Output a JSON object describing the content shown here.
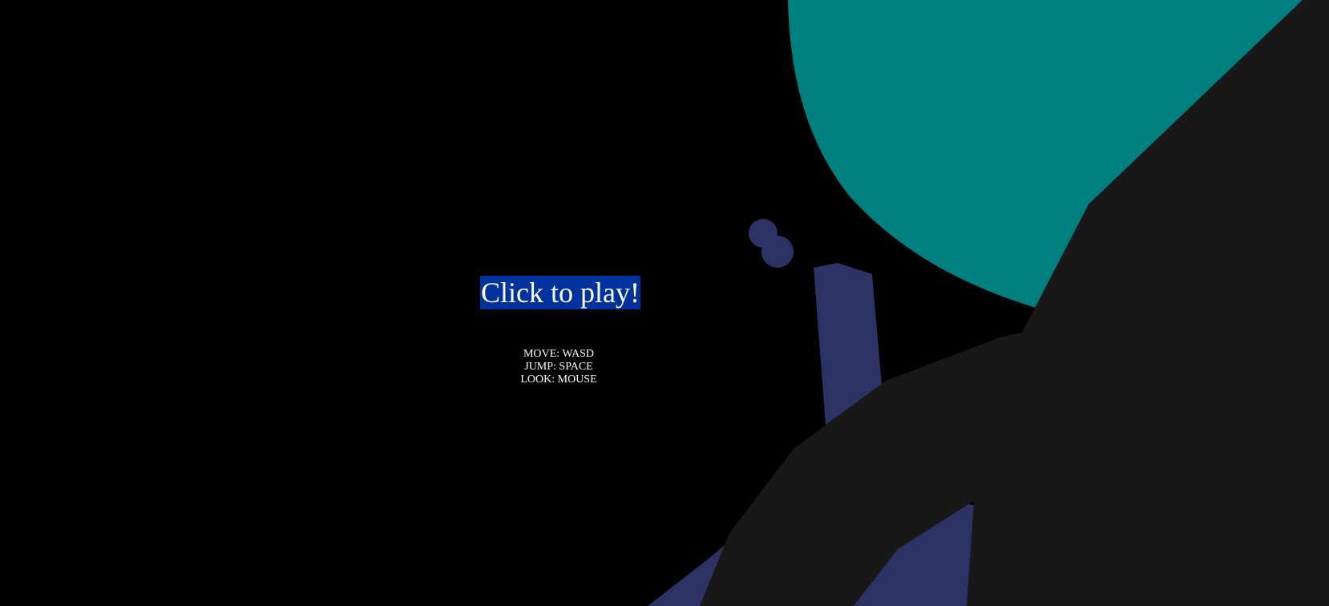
{
  "colors": {
    "background": "#000000",
    "sky_disc": "#007f7f",
    "terrain": "#181818",
    "pillar": "#2c3264",
    "button_background": "#00329e",
    "text": "#ffffff"
  },
  "menu": {
    "play_label": "Click to play!",
    "controls": [
      {
        "label": "MOVE: WASD"
      },
      {
        "label": "JUMP: SPACE"
      },
      {
        "label": "LOOK: MOUSE"
      }
    ]
  }
}
